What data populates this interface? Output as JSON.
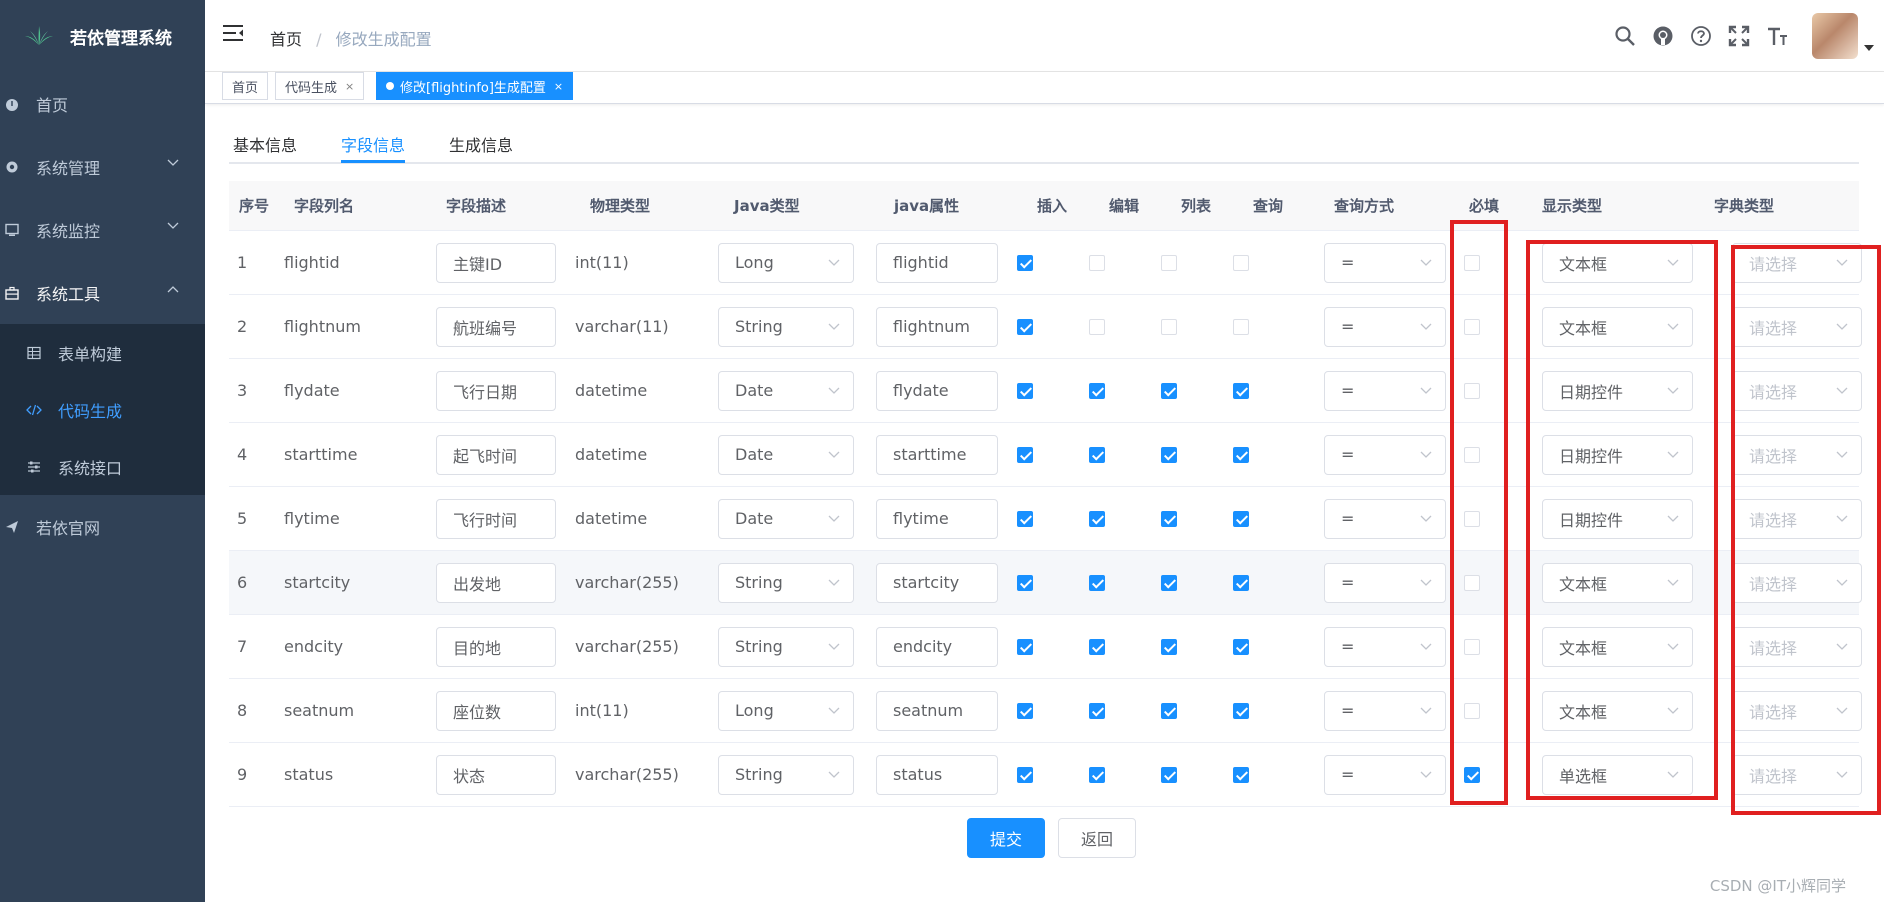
{
  "app": {
    "title": "若依管理系统"
  },
  "sidebar": {
    "items": [
      {
        "label": "首页",
        "icon": "dashboard-icon"
      },
      {
        "label": "系统管理",
        "icon": "gear-icon"
      },
      {
        "label": "系统监控",
        "icon": "monitor-icon"
      },
      {
        "label": "系统工具",
        "icon": "toolbox-icon"
      }
    ],
    "submenu": [
      {
        "label": "表单构建",
        "icon": "table-icon"
      },
      {
        "label": "代码生成",
        "icon": "code-icon"
      },
      {
        "label": "系统接口",
        "icon": "sliders-icon"
      }
    ],
    "last": {
      "label": "若依官网",
      "icon": "send-icon"
    }
  },
  "navbar": {
    "breadcrumb": {
      "home": "首页",
      "separator": "/",
      "current": "修改生成配置"
    }
  },
  "tags": [
    {
      "label": "首页"
    },
    {
      "label": "代码生成",
      "close": "×"
    },
    {
      "label": "修改[flightinfo]生成配置",
      "close": "×"
    }
  ],
  "tabs": [
    {
      "label": "基本信息"
    },
    {
      "label": "字段信息"
    },
    {
      "label": "生成信息"
    }
  ],
  "table": {
    "headers": [
      "序号",
      "字段列名",
      "字段描述",
      "物理类型",
      "Java类型",
      "java属性",
      "插入",
      "编辑",
      "列表",
      "查询",
      "查询方式",
      "必填",
      "显示类型",
      "字典类型"
    ],
    "rows": [
      {
        "idx": "1",
        "col": "flightid",
        "desc": "主键ID",
        "ptype": "int(11)",
        "jtype": "Long",
        "jprop": "flightid",
        "insert": true,
        "edit": false,
        "list": false,
        "query": false,
        "qtype": "=",
        "required": false,
        "html": "文本框"
      },
      {
        "idx": "2",
        "col": "flightnum",
        "desc": "航班编号",
        "ptype": "varchar(11)",
        "jtype": "String",
        "jprop": "flightnum",
        "insert": true,
        "edit": false,
        "list": false,
        "query": false,
        "qtype": "=",
        "required": false,
        "html": "文本框"
      },
      {
        "idx": "3",
        "col": "flydate",
        "desc": "飞行日期",
        "ptype": "datetime",
        "jtype": "Date",
        "jprop": "flydate",
        "insert": true,
        "edit": true,
        "list": true,
        "query": true,
        "qtype": "=",
        "required": false,
        "html": "日期控件"
      },
      {
        "idx": "4",
        "col": "starttime",
        "desc": "起飞时间",
        "ptype": "datetime",
        "jtype": "Date",
        "jprop": "starttime",
        "insert": true,
        "edit": true,
        "list": true,
        "query": true,
        "qtype": "=",
        "required": false,
        "html": "日期控件"
      },
      {
        "idx": "5",
        "col": "flytime",
        "desc": "飞行时间",
        "ptype": "datetime",
        "jtype": "Date",
        "jprop": "flytime",
        "insert": true,
        "edit": true,
        "list": true,
        "query": true,
        "qtype": "=",
        "required": false,
        "html": "日期控件"
      },
      {
        "idx": "6",
        "col": "startcity",
        "desc": "出发地",
        "ptype": "varchar(255)",
        "jtype": "String",
        "jprop": "startcity",
        "insert": true,
        "edit": true,
        "list": true,
        "query": true,
        "qtype": "=",
        "required": false,
        "html": "文本框"
      },
      {
        "idx": "7",
        "col": "endcity",
        "desc": "目的地",
        "ptype": "varchar(255)",
        "jtype": "String",
        "jprop": "endcity",
        "insert": true,
        "edit": true,
        "list": true,
        "query": true,
        "qtype": "=",
        "required": false,
        "html": "文本框"
      },
      {
        "idx": "8",
        "col": "seatnum",
        "desc": "座位数",
        "ptype": "int(11)",
        "jtype": "Long",
        "jprop": "seatnum",
        "insert": true,
        "edit": true,
        "list": true,
        "query": true,
        "qtype": "=",
        "required": false,
        "html": "文本框"
      },
      {
        "idx": "9",
        "col": "status",
        "desc": "状态",
        "ptype": "varchar(255)",
        "jtype": "String",
        "jprop": "status",
        "insert": true,
        "edit": true,
        "list": true,
        "query": true,
        "qtype": "=",
        "required": true,
        "html": "单选框"
      }
    ],
    "dict_placeholder": "请选择"
  },
  "buttons": {
    "submit": "提交",
    "back": "返回"
  },
  "watermark": "CSDN @IT小辉同学",
  "colors": {
    "sidebar_bg": "#304156",
    "primary": "#1890ff",
    "annotation": "#e02020"
  }
}
